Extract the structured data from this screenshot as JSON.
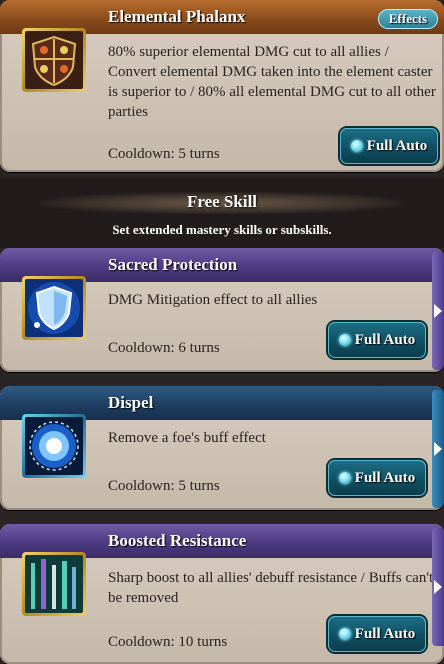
{
  "skills": [
    {
      "title": "Elemental Phalanx",
      "description": "80% superior elemental DMG cut to all allies / Convert elemental DMG taken into the element caster is superior to / 80% all elemental DMG cut to all other parties",
      "cooldown": "Cooldown: 5 turns",
      "button": "Full Auto",
      "effects_label": "Effects",
      "icon": "elemental-shield-icon"
    },
    {
      "title": "Sacred Protection",
      "description": "DMG Mitigation effect to all allies",
      "cooldown": "Cooldown: 6 turns",
      "button": "Full Auto",
      "icon": "holy-shield-icon"
    },
    {
      "title": "Dispel",
      "description": "Remove a foe's buff effect",
      "cooldown": "Cooldown: 5 turns",
      "button": "Full Auto",
      "icon": "dispel-orb-icon"
    },
    {
      "title": "Boosted Resistance",
      "description": "Sharp boost to all allies' debuff resistance / Buffs can't be removed",
      "cooldown": "Cooldown: 10 turns",
      "button": "Full Auto",
      "icon": "resistance-aura-icon"
    }
  ],
  "free_skill": {
    "title": "Free Skill",
    "subtitle": "Set extended mastery skills or subskills."
  },
  "colors": {
    "header_brown": "#8c4d1d",
    "header_purple": "#4e3b82",
    "header_blue": "#1e3f62",
    "button_teal": "#0f4d60"
  }
}
